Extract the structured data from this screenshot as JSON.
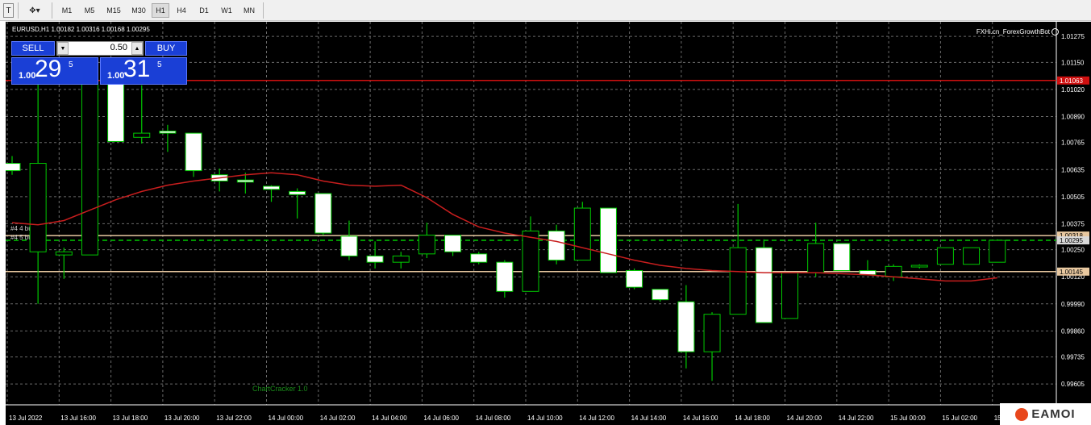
{
  "toolbar": {
    "text_tool_icon": "text-tool-icon",
    "shapes_icon": "shapes-dropdown-icon",
    "timeframes": [
      "M1",
      "M5",
      "M15",
      "M30",
      "H1",
      "H4",
      "D1",
      "W1",
      "MN"
    ],
    "active_timeframe": "H1",
    "text_tool_glyph": "T",
    "shapes_glyph": "✥▾"
  },
  "chart": {
    "symbol_line": "EURUSD,H1  1.00182 1.00316 1.00168 1.00295",
    "ea_name": "FXHi.cn_ForexGrowthBot",
    "indicator_label": "ChartCracker 1.0",
    "order_label_1": "#4   4 buy 0.0",
    "order_label_2": "#4   5 buy 0.0",
    "background": "#000000",
    "bull_color": "#000000",
    "bear_color": "#ffffff",
    "wick_color": "#00c800",
    "ma_color": "#c81e1e",
    "red_line_color": "#d01010",
    "tan_line_color": "#e8c8a0"
  },
  "trade_panel": {
    "sell_label": "SELL",
    "buy_label": "BUY",
    "volume": "0.50",
    "sell_price_small": "1.00",
    "sell_price_big": "29",
    "sell_price_sup": "5",
    "buy_price_small": "1.00",
    "buy_price_big": "31",
    "buy_price_sup": "5"
  },
  "price_axis": {
    "labels": [
      "1.01275",
      "1.01150",
      "1.01020",
      "1.00890",
      "1.00765",
      "1.00635",
      "1.00505",
      "1.00375",
      "1.00250",
      "1.00120",
      "0.99990",
      "0.99860",
      "0.99735",
      "0.99605"
    ],
    "ylim": [
      0.99505,
      1.01345
    ],
    "red_line": "1.01063",
    "tan_line_1": "1.00318",
    "bid_line": "1.00295",
    "tan_line_2": "1.00145"
  },
  "time_axis": {
    "labels": [
      "13 Jul 2022",
      "13 Jul 16:00",
      "13 Jul 18:00",
      "13 Jul 20:00",
      "13 Jul 22:00",
      "14 Jul 00:00",
      "14 Jul 02:00",
      "14 Jul 04:00",
      "14 Jul 06:00",
      "14 Jul 08:00",
      "14 Jul 10:00",
      "14 Jul 12:00",
      "14 Jul 14:00",
      "14 Jul 16:00",
      "14 Jul 18:00",
      "14 Jul 20:00",
      "14 Jul 22:00",
      "15 Jul 00:00",
      "15 Jul 02:00",
      "15 Jul"
    ]
  },
  "chart_data": {
    "type": "candlestick",
    "candles": [
      {
        "o": 1.00665,
        "h": 1.007,
        "l": 1.0061,
        "c": 1.0063
      },
      {
        "o": 1.0024,
        "h": 1.0105,
        "l": 0.9999,
        "c": 1.00665
      },
      {
        "o": 1.00225,
        "h": 1.0026,
        "l": 1.0011,
        "c": 1.0024
      },
      {
        "o": 1.00225,
        "h": 1.0115,
        "l": 1.00225,
        "c": 1.0115
      },
      {
        "o": 1.0106,
        "h": 1.0115,
        "l": 1.0077,
        "c": 1.0077
      },
      {
        "o": 1.0079,
        "h": 1.0104,
        "l": 1.0076,
        "c": 1.0081
      },
      {
        "o": 1.0082,
        "h": 1.0085,
        "l": 1.0072,
        "c": 1.0081
      },
      {
        "o": 1.0081,
        "h": 1.0081,
        "l": 1.006,
        "c": 1.0063
      },
      {
        "o": 1.0061,
        "h": 1.0064,
        "l": 1.0053,
        "c": 1.0058
      },
      {
        "o": 1.00585,
        "h": 1.0062,
        "l": 1.0052,
        "c": 1.00575
      },
      {
        "o": 1.00555,
        "h": 1.0056,
        "l": 1.0048,
        "c": 1.0054
      },
      {
        "o": 1.0053,
        "h": 1.00545,
        "l": 1.004,
        "c": 1.00515
      },
      {
        "o": 1.0052,
        "h": 1.0052,
        "l": 1.0032,
        "c": 1.0033
      },
      {
        "o": 1.00315,
        "h": 1.0039,
        "l": 1.002,
        "c": 1.0022
      },
      {
        "o": 1.0022,
        "h": 1.0029,
        "l": 1.0016,
        "c": 1.0019
      },
      {
        "o": 1.0019,
        "h": 1.0024,
        "l": 1.0016,
        "c": 1.0022
      },
      {
        "o": 1.0023,
        "h": 1.0038,
        "l": 1.0021,
        "c": 1.0032
      },
      {
        "o": 1.0032,
        "h": 1.0032,
        "l": 1.0022,
        "c": 1.0024
      },
      {
        "o": 1.0023,
        "h": 1.0024,
        "l": 1.0018,
        "c": 1.0019
      },
      {
        "o": 1.0019,
        "h": 1.002,
        "l": 1.0002,
        "c": 1.0005
      },
      {
        "o": 1.0005,
        "h": 1.0041,
        "l": 1.0005,
        "c": 1.0034
      },
      {
        "o": 1.0034,
        "h": 1.0037,
        "l": 1.0018,
        "c": 1.002
      },
      {
        "o": 1.002,
        "h": 1.0048,
        "l": 1.002,
        "c": 1.0045
      },
      {
        "o": 1.0045,
        "h": 1.0045,
        "l": 1.0014,
        "c": 1.0014
      },
      {
        "o": 1.0015,
        "h": 1.0016,
        "l": 1.0006,
        "c": 1.0007
      },
      {
        "o": 1.0006,
        "h": 1.0006,
        "l": 1.0,
        "c": 1.0001
      },
      {
        "o": 1.0,
        "h": 1.0008,
        "l": 0.9968,
        "c": 0.9976
      },
      {
        "o": 0.9976,
        "h": 0.9995,
        "l": 0.9962,
        "c": 0.9994
      },
      {
        "o": 0.9994,
        "h": 1.0047,
        "l": 0.9994,
        "c": 1.0026
      },
      {
        "o": 1.0026,
        "h": 1.003,
        "l": 0.999,
        "c": 0.999
      },
      {
        "o": 0.9992,
        "h": 1.0014,
        "l": 0.9992,
        "c": 1.0014
      },
      {
        "o": 1.0014,
        "h": 1.0038,
        "l": 1.0012,
        "c": 1.0028
      },
      {
        "o": 1.0028,
        "h": 1.0028,
        "l": 1.0015,
        "c": 1.0015
      },
      {
        "o": 1.0015,
        "h": 1.002,
        "l": 1.0013,
        "c": 1.0013
      },
      {
        "o": 1.0012,
        "h": 1.0018,
        "l": 1.001,
        "c": 1.0017
      },
      {
        "o": 1.00175,
        "h": 1.0018,
        "l": 1.0016,
        "c": 1.00175
      },
      {
        "o": 1.0018,
        "h": 1.0026,
        "l": 1.0018,
        "c": 1.0026
      },
      {
        "o": 1.0018,
        "h": 1.0026,
        "l": 1.0018,
        "c": 1.0026
      },
      {
        "o": 1.0019,
        "h": 1.003,
        "l": 1.0019,
        "c": 1.00295
      }
    ],
    "moving_average": [
      1.0038,
      1.0037,
      1.0039,
      1.0044,
      1.0049,
      1.0053,
      1.0056,
      1.0058,
      1.00595,
      1.0061,
      1.0062,
      1.0061,
      1.0058,
      1.0056,
      1.00555,
      1.0056,
      1.005,
      1.0042,
      1.0036,
      1.0033,
      1.0031,
      1.0029,
      1.0026,
      1.0023,
      1.002,
      1.00175,
      1.0016,
      1.0015,
      1.00145,
      1.0014,
      1.0014,
      1.0014,
      1.00135,
      1.0013,
      1.0012,
      1.0011,
      1.001,
      1.001,
      1.00115
    ],
    "ylim": [
      0.99505,
      1.01345
    ]
  }
}
